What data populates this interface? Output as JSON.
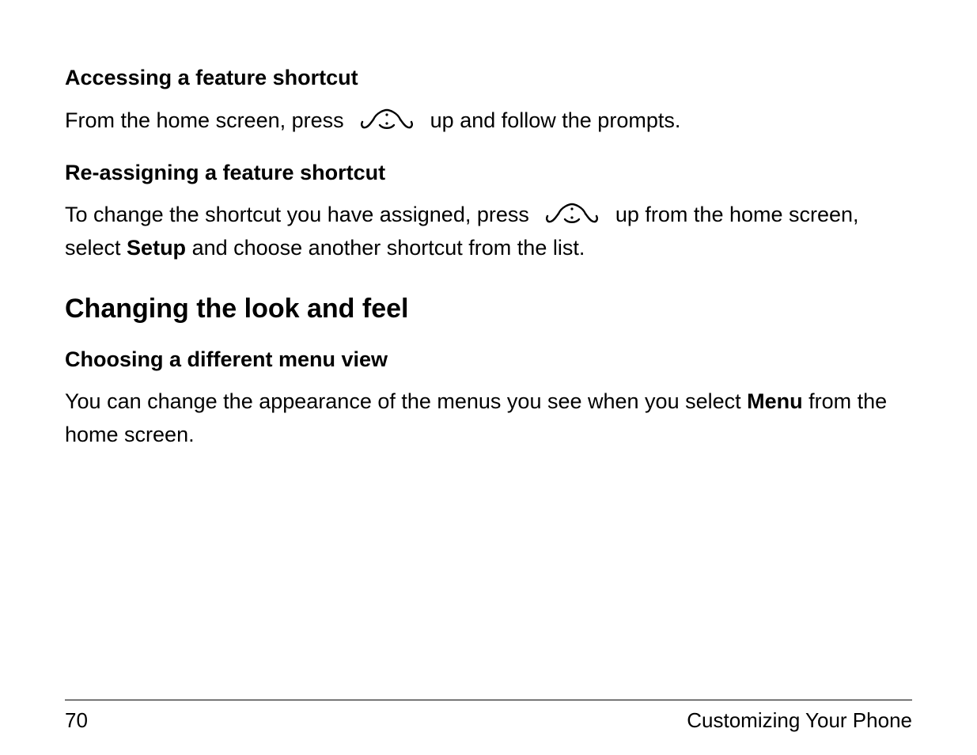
{
  "sections": {
    "accessing": {
      "heading": "Accessing a feature shortcut",
      "para_before_icon": "From the home screen, press ",
      "para_after_icon": " up and follow the prompts."
    },
    "reassigning": {
      "heading": "Re-assigning a feature shortcut",
      "para_before_icon": "To change the shortcut you have assigned, press ",
      "para_after_icon_1": " up from the home screen, select ",
      "bold_1": "Setup",
      "tail_1": " and choose another shortcut from the list."
    },
    "changing": {
      "heading": "Changing the look and feel"
    },
    "choosing": {
      "heading": "Choosing a different menu view",
      "para_1_a": "You can change the appearance of the menus you see when you select ",
      "bold_1": "Menu",
      "tail_1": " from the home screen."
    }
  },
  "footer": {
    "page_number": "70",
    "chapter": "Customizing Your Phone"
  }
}
